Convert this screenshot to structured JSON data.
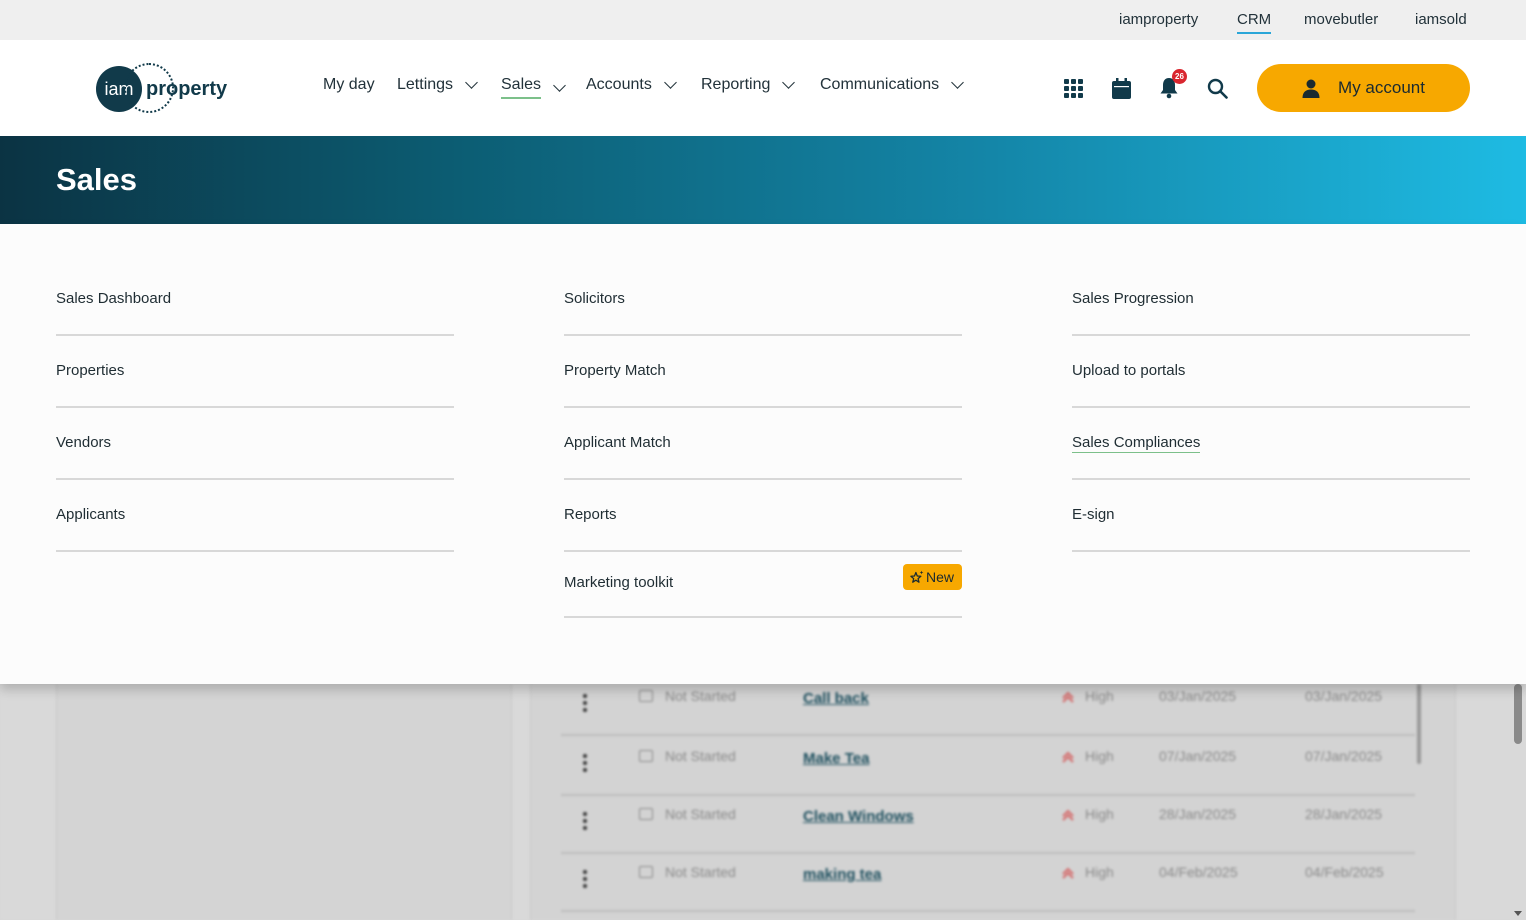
{
  "utility_links": [
    "iamproperty",
    "CRM",
    "movebutler",
    "iamsold"
  ],
  "utility_active": "CRM",
  "logo": {
    "mark": "iam",
    "word": "property"
  },
  "nav": [
    {
      "label": "My day",
      "has_dropdown": false
    },
    {
      "label": "Lettings",
      "has_dropdown": true
    },
    {
      "label": "Sales",
      "has_dropdown": true,
      "active": true
    },
    {
      "label": "Accounts",
      "has_dropdown": true
    },
    {
      "label": "Reporting",
      "has_dropdown": true
    },
    {
      "label": "Communications",
      "has_dropdown": true
    }
  ],
  "header_icons": [
    "apps-grid-icon",
    "calendar-icon",
    "bell-icon",
    "search-icon"
  ],
  "notification_count": "26",
  "account_button": "My account",
  "banner_title": "Sales",
  "mega_menu": {
    "columns": [
      [
        "Sales Dashboard",
        "Properties",
        "Vendors",
        "Applicants"
      ],
      [
        "Solicitors",
        "Property Match",
        "Applicant Match",
        "Reports",
        "Marketing toolkit"
      ],
      [
        "Sales Progression",
        "Upload to portals",
        "Sales Compliances",
        "E-sign"
      ]
    ],
    "new_badge": "New"
  },
  "background_tasks": [
    {
      "status": "Not Started",
      "task": "Call back",
      "priority": "High",
      "date1": "03/Jan/2025",
      "date2": "03/Jan/2025"
    },
    {
      "status": "Not Started",
      "task": "Make Tea",
      "priority": "High",
      "date1": "07/Jan/2025",
      "date2": "07/Jan/2025"
    },
    {
      "status": "Not Started",
      "task": "Clean Windows",
      "priority": "High",
      "date1": "28/Jan/2025",
      "date2": "28/Jan/2025"
    },
    {
      "status": "Not Started",
      "task": "making tea",
      "priority": "High",
      "date1": "04/Feb/2025",
      "date2": "04/Feb/2025"
    }
  ],
  "colors": {
    "accent": "#f7a800",
    "brand": "#113a4a",
    "active_underline": "#7cc08a",
    "crm_underline": "#2aa6d8",
    "badge_red": "#d9262f"
  }
}
